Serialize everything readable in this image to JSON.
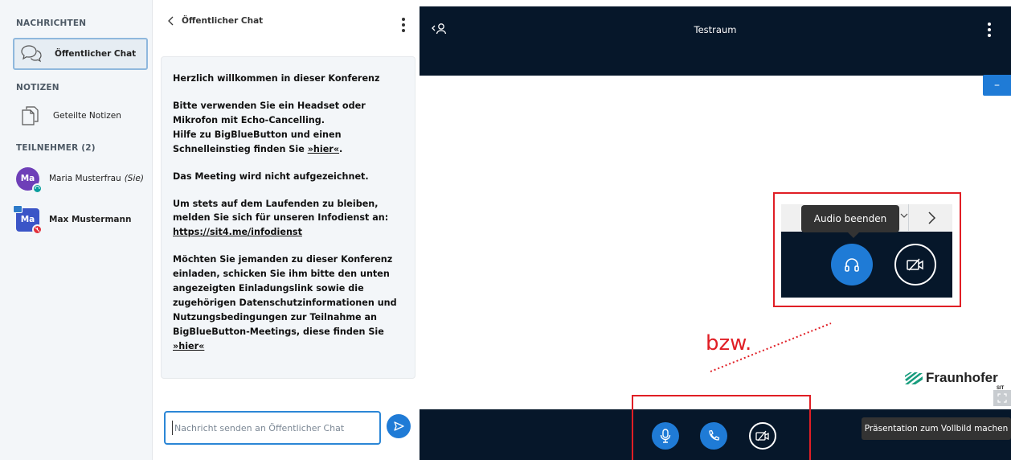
{
  "sidebar": {
    "messages_title": "NACHRICHTEN",
    "public_chat_label": "Öffentlicher Chat",
    "notes_title": "NOTIZEN",
    "shared_notes_label": "Geteilte Notizen",
    "participants_title": "TEILNEHMER (2)",
    "participants": [
      {
        "initials": "Ma",
        "name": "Maria Musterfrau",
        "suffix": "(Sie)",
        "color": "#6e3fb8",
        "badge_color": "#0a9e9e"
      },
      {
        "initials": "Ma",
        "name": "Max Mustermann",
        "suffix": "",
        "color": "#3b55c7",
        "badge_color": "#e2313b"
      }
    ]
  },
  "chat": {
    "header_title": "Öffentlicher Chat",
    "welcome": "Herzlich willkommen in dieser Konferenz",
    "p2_line1": "Bitte verwenden Sie ein Headset oder Mikrofon mit Echo-Cancelling.",
    "p2_line2": "Hilfe zu BigBlueButton und einen Schnelleinstieg finden Sie ",
    "p2_link": "»hier«",
    "p2_end": ".",
    "p3": "Das Meeting wird nicht aufgezeichnet.",
    "p4": "Um stets auf dem Laufenden zu bleiben, melden Sie sich für unseren Infodienst an:",
    "p4_link": "https://sit4.me/infodienst",
    "p5_a": "Möchten Sie jemanden zu dieser Konferenz einladen, schicken Sie ihm bitte den unten angezeigten Einladungslink sowie die zugehörigen ",
    "p5_b": "Datenschutzinformationen",
    "p5_c": " und ",
    "p5_d": "Nutzungsbedingungen",
    "p5_e": " zur Teilnahme an BigBlueButton-Meetings, diese finden Sie ",
    "p5_link": "»hier«",
    "input_placeholder": "Nachricht senden an Öffentlicher Chat"
  },
  "stage": {
    "room_title": "Testraum",
    "minimize_label": "–",
    "tooltip_audio": "Audio beenden",
    "annotation": "bzw.",
    "logo_text": "Fraunhofer",
    "logo_sub": "SIT",
    "tooltip_fullscreen": "Präsentation zum Vollbild machen"
  },
  "colors": {
    "accent": "#1f7bd6",
    "dark_bar": "#06172a",
    "annotation_red": "#e01e25",
    "fraunhofer_green": "#179c7d"
  }
}
